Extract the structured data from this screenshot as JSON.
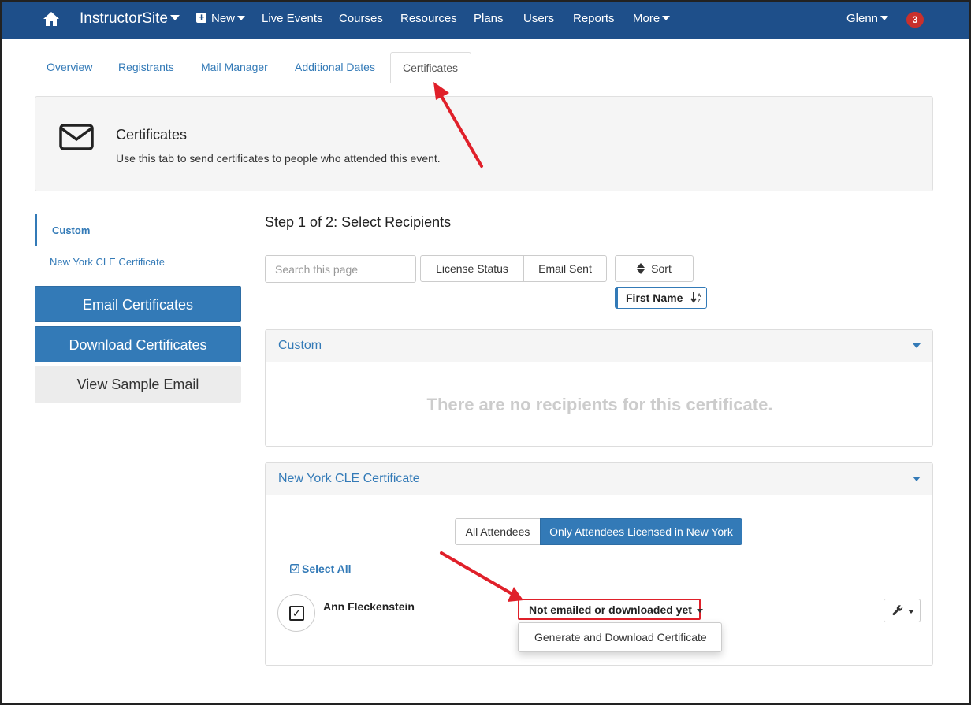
{
  "navbar": {
    "brand": "InstructorSite",
    "new_label": "New",
    "items": [
      "Live Events",
      "Courses",
      "Resources",
      "Plans",
      "Users",
      "Reports"
    ],
    "more_label": "More",
    "user_label": "Glenn",
    "notification_count": "3",
    "colors": {
      "bar": "#1e4f8a",
      "badge": "#c9302c"
    }
  },
  "tabs": [
    "Overview",
    "Registrants",
    "Mail Manager",
    "Additional Dates",
    "Certificates"
  ],
  "active_tab": "Certificates",
  "info": {
    "title": "Certificates",
    "description": "Use this tab to send certificates to people who attended this event.",
    "icon": "envelope-icon"
  },
  "sidebar": {
    "links": [
      "Custom",
      "New York CLE Certificate"
    ],
    "active_link": "Custom",
    "buttons": {
      "email": "Email Certificates",
      "download": "Download Certificates",
      "sample": "View Sample Email"
    }
  },
  "main": {
    "step_title": "Step 1 of 2: Select Recipients",
    "search_placeholder": "Search this page",
    "filters": [
      "License Status",
      "Email Sent"
    ],
    "sort_label": "Sort",
    "sort_chip": "First Name",
    "panels": {
      "custom": {
        "title": "Custom",
        "empty_message": "There are no recipients for this certificate."
      },
      "ny": {
        "title": "New York CLE Certificate",
        "segments": [
          "All Attendees",
          "Only Attendees Licensed in New York"
        ],
        "select_all": "Select All",
        "attendee": {
          "name": "Ann Fleckenstein",
          "status": "Not emailed or downloaded yet",
          "menu_item": "Generate and Download Certificate"
        }
      }
    }
  },
  "colors": {
    "primary": "#337ab7",
    "annotation": "#e0202a"
  }
}
